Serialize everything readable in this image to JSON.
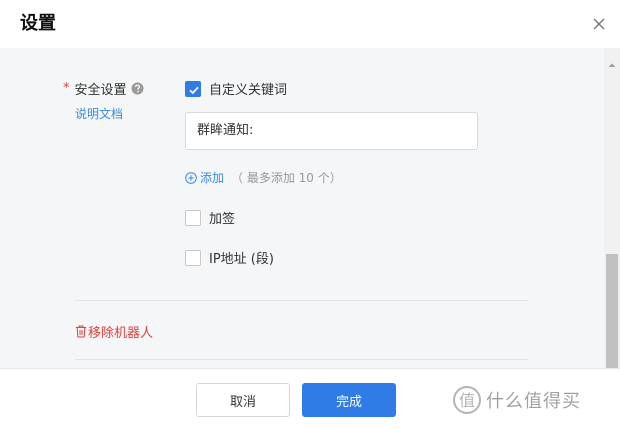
{
  "dialog": {
    "title": "设置",
    "close_icon": "close-icon"
  },
  "security": {
    "required_mark": "*",
    "label": "安全设置",
    "help_icon": "question-circle-icon",
    "doc_link": "说明文档",
    "custom_keyword": {
      "label": "自定义关键词",
      "checked": true
    },
    "keyword_input": {
      "value": "群眸通知:"
    },
    "add": {
      "label": "添加",
      "hint": "（ 最多添加 10 个）"
    },
    "sign": {
      "label": "加签",
      "checked": false
    },
    "ip": {
      "label": "IP地址 (段)",
      "checked": false
    }
  },
  "remove_robot": {
    "label": "移除机器人",
    "icon": "trash-icon"
  },
  "footer": {
    "cancel_label": "取消",
    "ok_label": "完成"
  },
  "watermark": {
    "text": "什么值得买"
  },
  "colors": {
    "accent": "#2f7ce6",
    "link": "#3a8be0",
    "danger": "#e0413c"
  }
}
